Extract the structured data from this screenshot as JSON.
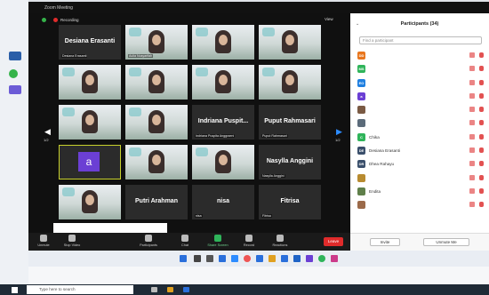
{
  "window": {
    "title": "Zoom Meeting",
    "recording_label": "Recording",
    "view_label": "View"
  },
  "gallery": {
    "page_left": "1/2",
    "page_right": "1/2",
    "tiles": [
      {
        "kind": "name",
        "big": "Desiana Erasanti",
        "sub": "Desiana Erasanti"
      },
      {
        "kind": "photo",
        "big": "",
        "sub": "Aulia Nusyarifah"
      },
      {
        "kind": "photo",
        "big": "",
        "sub": ""
      },
      {
        "kind": "photo",
        "big": "",
        "sub": ""
      },
      {
        "kind": "photo",
        "big": "",
        "sub": ""
      },
      {
        "kind": "photo",
        "big": "",
        "sub": ""
      },
      {
        "kind": "photo",
        "big": "",
        "sub": ""
      },
      {
        "kind": "photo",
        "big": "",
        "sub": ""
      },
      {
        "kind": "photo",
        "big": "",
        "sub": ""
      },
      {
        "kind": "photo",
        "big": "",
        "sub": ""
      },
      {
        "kind": "name",
        "big": "Indriana Puspit...",
        "sub": "Indriana Puspita Anggraeni"
      },
      {
        "kind": "name",
        "big": "Puput Rahmasari",
        "sub": "Puput Rahmasari"
      },
      {
        "kind": "avatar",
        "big": "a",
        "sub": ""
      },
      {
        "kind": "photo",
        "big": "",
        "sub": ""
      },
      {
        "kind": "photo",
        "big": "",
        "sub": ""
      },
      {
        "kind": "name",
        "big": "Nasylla Anggini",
        "sub": "Nasylla Anggini"
      },
      {
        "kind": "photo",
        "big": "",
        "sub": ""
      },
      {
        "kind": "name",
        "big": "Putri Arahman",
        "sub": ""
      },
      {
        "kind": "name",
        "big": "nisa",
        "sub": "nisa"
      },
      {
        "kind": "name",
        "big": "Fitrisa",
        "sub": "Fitrisa"
      }
    ]
  },
  "tooltip": "",
  "toolbar": {
    "unmute": "Unmute",
    "stop_video": "Stop Video",
    "participants": "Participants",
    "chat": "Chat",
    "share": "Share Screen",
    "record": "Record",
    "reactions": "Reactions",
    "leave": "Leave"
  },
  "participants": {
    "title": "Participants (34)",
    "search_placeholder": "Find a participant",
    "list": [
      {
        "initials": "DD",
        "color": "#e8761d",
        "name": ""
      },
      {
        "initials": "MS",
        "color": "#2fb45a",
        "name": ""
      },
      {
        "initials": "EO",
        "color": "#1f7fe0",
        "name": ""
      },
      {
        "initials": "a",
        "color": "#6b3fd4",
        "name": ""
      },
      {
        "initials": "",
        "color": "#7a5a44",
        "name": ""
      },
      {
        "initials": "",
        "color": "#5b6b7a",
        "name": ""
      },
      {
        "initials": "C",
        "color": "#2fb45a",
        "name": "Chika"
      },
      {
        "initials": "DE",
        "color": "#3a4f6b",
        "name": "Desiana Erasanti"
      },
      {
        "initials": "DR",
        "color": "#3a4f6b",
        "name": "Dhea Rahayu"
      },
      {
        "initials": "",
        "color": "#b88b30",
        "name": ""
      },
      {
        "initials": "",
        "color": "#5f7f4a",
        "name": "Endita"
      },
      {
        "initials": "",
        "color": "#9b6a4a",
        "name": ""
      }
    ],
    "invite_label": "Invite",
    "unmute_me_label": "Unmute Me"
  },
  "desktop": {
    "email": "",
    "clock_inner_time": "",
    "clock_inner_date": "",
    "taskbar_search": "Type here to search",
    "clock_time": "",
    "clock_date": ""
  }
}
